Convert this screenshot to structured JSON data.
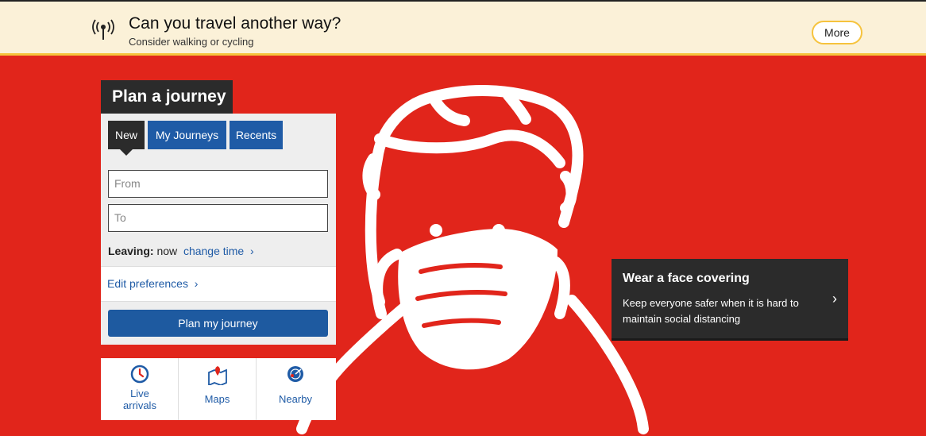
{
  "banner": {
    "icon": "broadcast-icon",
    "title": "Can you travel another way?",
    "subtitle": "Consider walking or cycling",
    "more_label": "More"
  },
  "planner": {
    "title": "Plan a journey",
    "tabs": [
      {
        "label": "New",
        "active": true
      },
      {
        "label": "My Journeys",
        "active": false
      },
      {
        "label": "Recents",
        "active": false
      }
    ],
    "from_placeholder": "From",
    "to_placeholder": "To",
    "leaving_label": "Leaving:",
    "leaving_value": "now",
    "change_time_label": "change time",
    "edit_preferences_label": "Edit preferences",
    "plan_button_label": "Plan my journey"
  },
  "shortcuts": [
    {
      "label": "Live arrivals",
      "icon": "clock-icon"
    },
    {
      "label": "Maps",
      "icon": "map-pin-icon"
    },
    {
      "label": "Nearby",
      "icon": "radar-icon"
    }
  ],
  "promo": {
    "title": "Wear a face covering",
    "body": "Keep everyone safer when it is hard to maintain social distancing"
  },
  "colors": {
    "hero_red": "#e1251b",
    "banner_bg": "#fbf1d8",
    "accent_yellow": "#f6c33d",
    "link_blue": "#1f5ba6",
    "panel_dark": "#2b2b2b"
  }
}
